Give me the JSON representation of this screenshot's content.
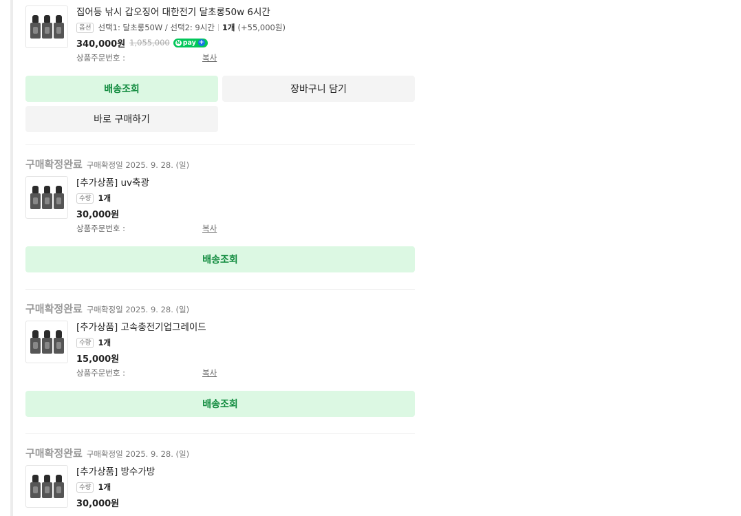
{
  "orders": [
    {
      "product_name": "집어등 낚시 갑오징어 대한전기 달초롱50w 6시간",
      "option_tag": "옵션",
      "option_text": "선택1: 달초롱50W / 선택2: 9시간",
      "option_qty": "1개",
      "option_extra": "(+55,000원)",
      "price": "340,000원",
      "old_price": "1,055,000",
      "npay_label": "pay",
      "order_no_label": "상품주문번호 :",
      "copy_label": "복사",
      "buttons": {
        "track": "배송조회",
        "cart": "장바구니 담기",
        "buy": "바로 구매하기"
      }
    },
    {
      "status": "구매확정완료",
      "status_date": "구매확정일 2025. 9. 28. (일)",
      "product_name": "[추가상품] uv축광",
      "qty_tag": "수량",
      "qty": "1개",
      "price": "30,000원",
      "order_no_label": "상품주문번호 :",
      "copy_label": "복사",
      "track_label": "배송조회"
    },
    {
      "status": "구매확정완료",
      "status_date": "구매확정일 2025. 9. 28. (일)",
      "product_name": "[추가상품] 고속충전기업그레이드",
      "qty_tag": "수량",
      "qty": "1개",
      "price": "15,000원",
      "order_no_label": "상품주문번호 :",
      "copy_label": "복사",
      "track_label": "배송조회"
    },
    {
      "status": "구매확정완료",
      "status_date": "구매확정일 2025. 9. 28. (일)",
      "product_name": "[추가상품] 방수가방",
      "qty_tag": "수량",
      "qty": "1개",
      "price": "30,000원"
    }
  ],
  "colors": {
    "accent_green": "#0f8a3d",
    "green_bg": "#dcf8e3",
    "npay_green": "#03c75a"
  }
}
